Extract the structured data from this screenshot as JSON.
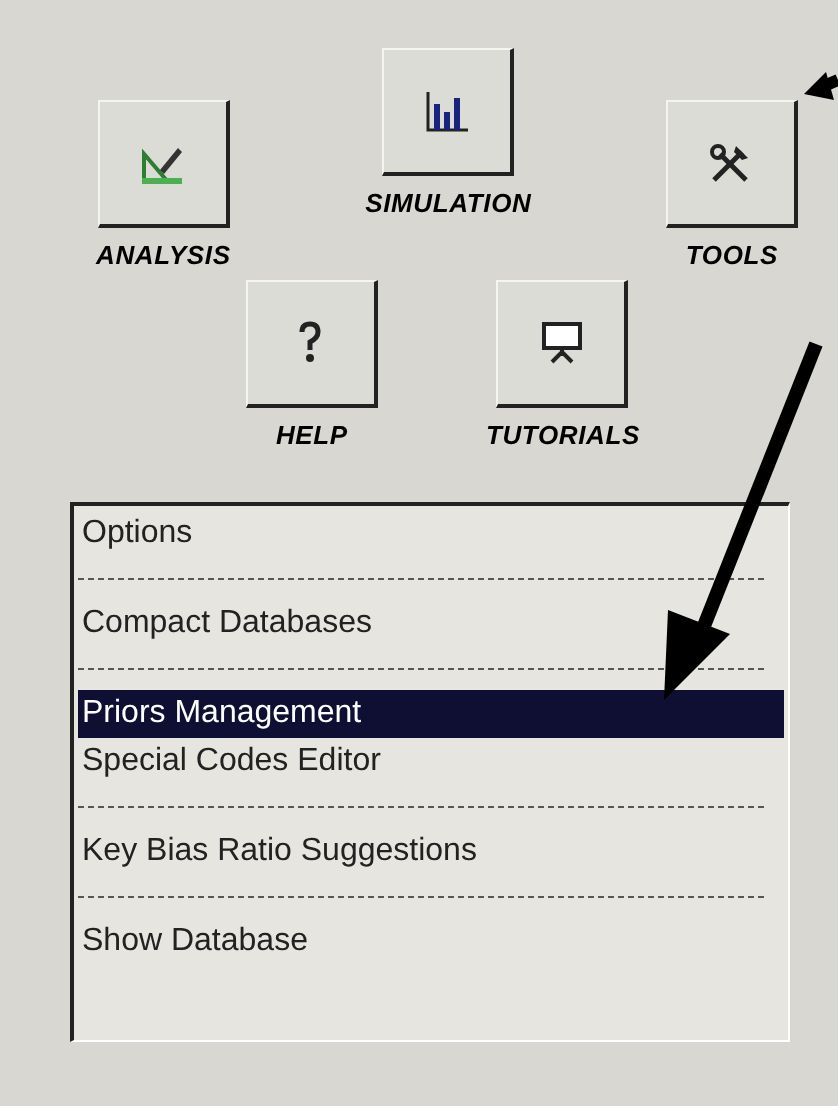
{
  "launchers": [
    {
      "kind": "analysis",
      "label": "ANALYSIS"
    },
    {
      "kind": "simulation",
      "label": "SIMULATION"
    },
    {
      "kind": "tools",
      "label": "TOOLS"
    },
    {
      "kind": "help",
      "label": "HELP"
    },
    {
      "kind": "tutorials",
      "label": "TUTORIALS"
    }
  ],
  "menu": [
    {
      "kind": "item",
      "label": "Options",
      "selected": false
    },
    {
      "kind": "separator"
    },
    {
      "kind": "item",
      "label": "Compact Databases",
      "selected": false
    },
    {
      "kind": "separator"
    },
    {
      "kind": "item",
      "label": "Priors Management",
      "selected": true
    },
    {
      "kind": "item",
      "label": "Special Codes Editor",
      "selected": false
    },
    {
      "kind": "separator"
    },
    {
      "kind": "item",
      "label": "Key Bias Ratio Suggestions",
      "selected": false
    },
    {
      "kind": "separator"
    },
    {
      "kind": "item",
      "label": "Show Database",
      "selected": false
    }
  ]
}
